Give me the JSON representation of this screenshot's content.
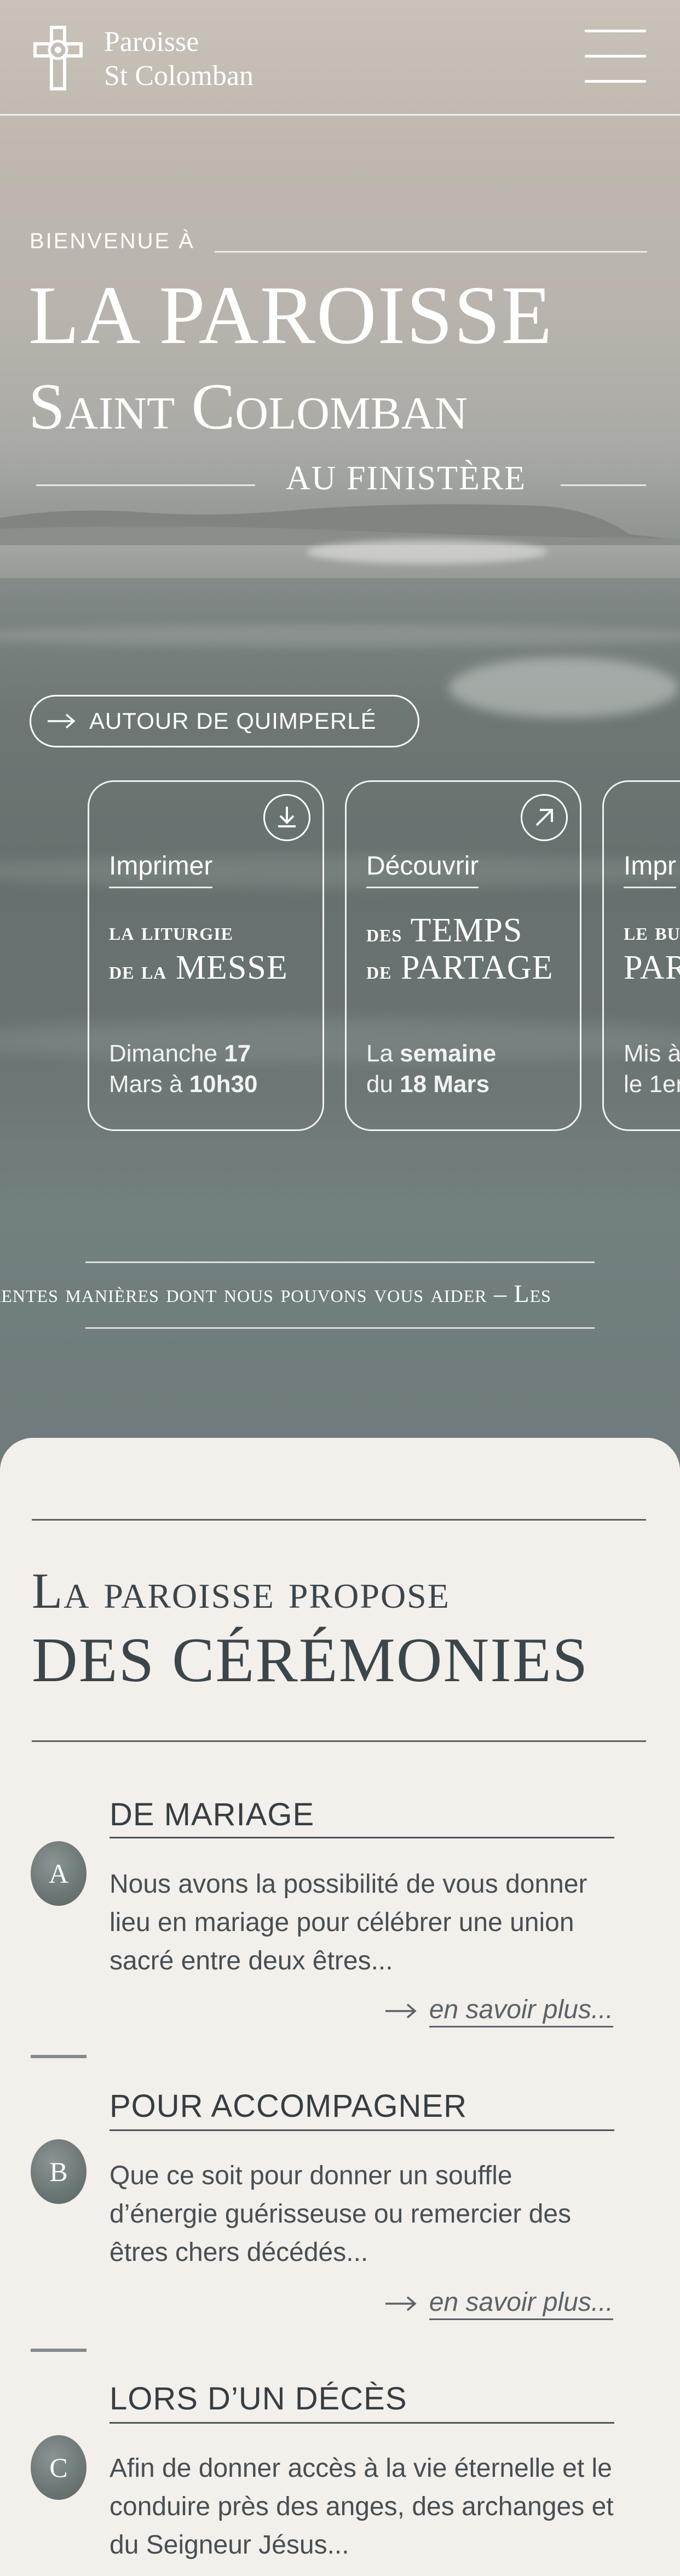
{
  "header": {
    "logo_line1": "Paroisse",
    "logo_line2": "St Colomban",
    "menu_icon": "hamburger-menu-icon"
  },
  "hero": {
    "welcome": "BIENVENUE À",
    "title_line1": "LA PAROISSE",
    "title_line2": "Saint Colomban",
    "subtitle": "AU FINISTÈRE",
    "location_button": "AUTOUR DE QUIMPERLÉ",
    "cards": [
      {
        "action": "Imprimer",
        "line1": "la liturgie",
        "line2a": "de la",
        "line2b": "MESSE",
        "date_a": "Dimanche ",
        "date_b": "17",
        "date_c": "Mars à ",
        "date_d": "10h30",
        "icon": "download-icon"
      },
      {
        "action": "Découvrir",
        "line1": "",
        "line2a": "des",
        "line2b": "TEMPS",
        "line3a": "de",
        "line3b": "PARTAGE",
        "date_a": "La ",
        "date_b": "semaine",
        "date_c": "du ",
        "date_d": "18 Mars",
        "icon": "arrow-up-right-icon"
      },
      {
        "action": "Impr",
        "line1": "le bu",
        "line2": "PAR",
        "date_a": "Mis à",
        "date_c": "le 1er"
      }
    ],
    "marquee": "rentes manières dont nous pouvons vous aider – Les"
  },
  "ceremonies": {
    "title_line1": "La paroisse propose",
    "title_line2": "DES CÉRÉMONIES",
    "items": [
      {
        "badge": "A",
        "title": "DE MARIAGE",
        "text": "Nous avons la possibilité de vous donner lieu en mariage pour célébrer une union sacré entre deux êtres...",
        "more": "en savoir plus..."
      },
      {
        "badge": "B",
        "title": "POUR ACCOMPAGNER",
        "text": "Que ce soit pour donner un souffle d’énergie guérisseuse ou remercier des êtres chers décédés...",
        "more": "en savoir plus..."
      },
      {
        "badge": "C",
        "title": "LORS D’UN DÉCÈS",
        "text": "Afin de donner accès à la vie éternelle et le conduire près des anges, des archanges et du Seigneur Jésus..."
      }
    ]
  }
}
